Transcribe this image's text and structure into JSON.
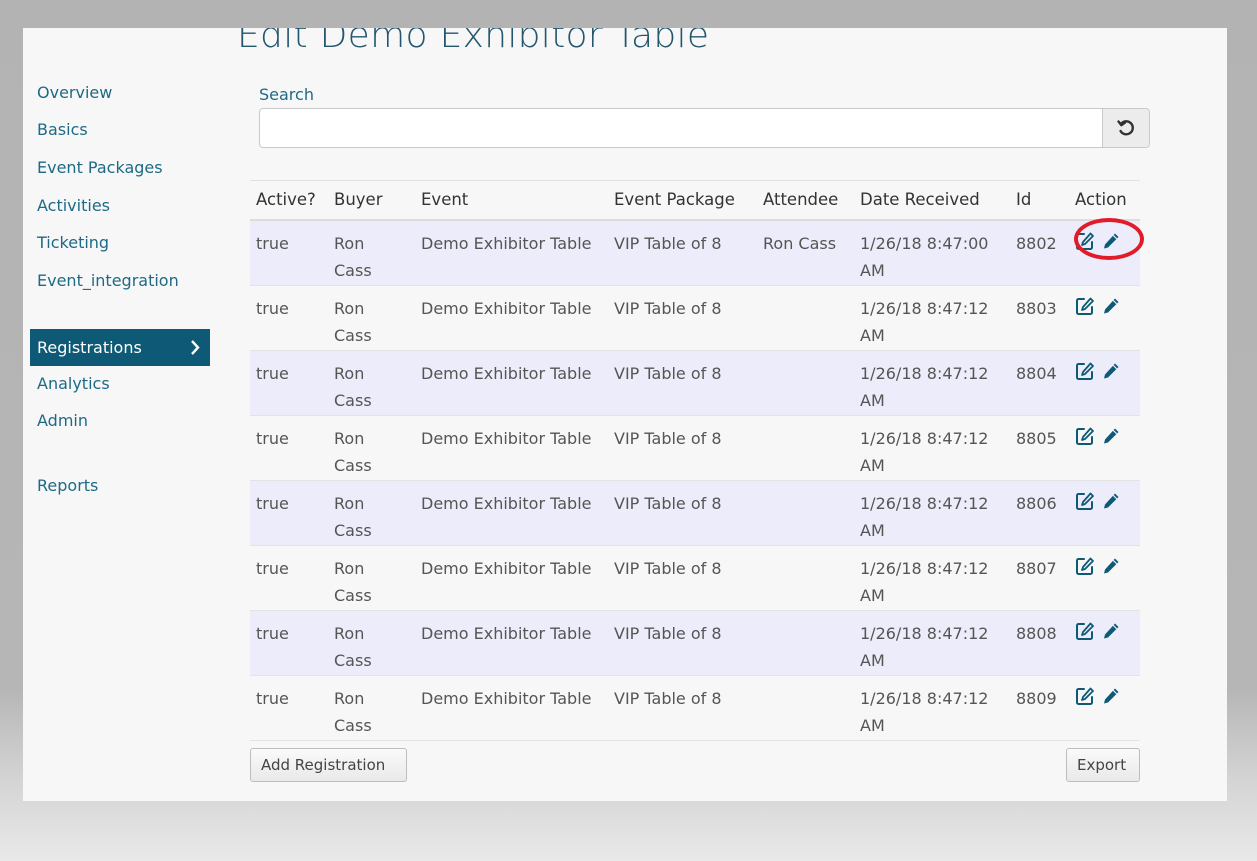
{
  "page": {
    "title": "Edit Demo Exhibitor Table"
  },
  "sidebar": {
    "items": [
      {
        "label": "Overview"
      },
      {
        "label": "Basics"
      },
      {
        "label": "Event Packages"
      },
      {
        "label": "Activities"
      },
      {
        "label": "Ticketing"
      },
      {
        "label": "Event_integration"
      },
      {
        "label": "Registrations",
        "active": true
      },
      {
        "label": "Analytics"
      },
      {
        "label": "Admin"
      },
      {
        "label": "Reports"
      }
    ]
  },
  "search": {
    "label": "Search",
    "value": "",
    "placeholder": ""
  },
  "table": {
    "headers": [
      "Active?",
      "Buyer",
      "Event",
      "Event Package",
      "Attendee",
      "Date Received",
      "Id",
      "Action"
    ],
    "rows": [
      {
        "active": "true",
        "buyer": "Ron Cass",
        "event": "Demo Exhibitor Table",
        "package": "VIP Table of 8",
        "attendee": "Ron Cass",
        "date": "1/26/18 8:47:00 AM",
        "id": "8802"
      },
      {
        "active": "true",
        "buyer": "Ron Cass",
        "event": "Demo Exhibitor Table",
        "package": "VIP Table of 8",
        "attendee": "",
        "date": "1/26/18 8:47:12 AM",
        "id": "8803"
      },
      {
        "active": "true",
        "buyer": "Ron Cass",
        "event": "Demo Exhibitor Table",
        "package": "VIP Table of 8",
        "attendee": "",
        "date": "1/26/18 8:47:12 AM",
        "id": "8804"
      },
      {
        "active": "true",
        "buyer": "Ron Cass",
        "event": "Demo Exhibitor Table",
        "package": "VIP Table of 8",
        "attendee": "",
        "date": "1/26/18 8:47:12 AM",
        "id": "8805"
      },
      {
        "active": "true",
        "buyer": "Ron Cass",
        "event": "Demo Exhibitor Table",
        "package": "VIP Table of 8",
        "attendee": "",
        "date": "1/26/18 8:47:12 AM",
        "id": "8806"
      },
      {
        "active": "true",
        "buyer": "Ron Cass",
        "event": "Demo Exhibitor Table",
        "package": "VIP Table of 8",
        "attendee": "",
        "date": "1/26/18 8:47:12 AM",
        "id": "8807"
      },
      {
        "active": "true",
        "buyer": "Ron Cass",
        "event": "Demo Exhibitor Table",
        "package": "VIP Table of 8",
        "attendee": "",
        "date": "1/26/18 8:47:12 AM",
        "id": "8808"
      },
      {
        "active": "true",
        "buyer": "Ron Cass",
        "event": "Demo Exhibitor Table",
        "package": "VIP Table of 8",
        "attendee": "",
        "date": "1/26/18 8:47:12 AM",
        "id": "8809"
      }
    ],
    "action_icons": [
      "edit-square-icon",
      "pencil-icon"
    ]
  },
  "buttons": {
    "add": "Add Registration",
    "export": "Export"
  },
  "colors": {
    "accent": "#0e5a76",
    "link": "#1e6a85",
    "highlight": "#e01c2a",
    "row_alt": "#ececfa"
  }
}
